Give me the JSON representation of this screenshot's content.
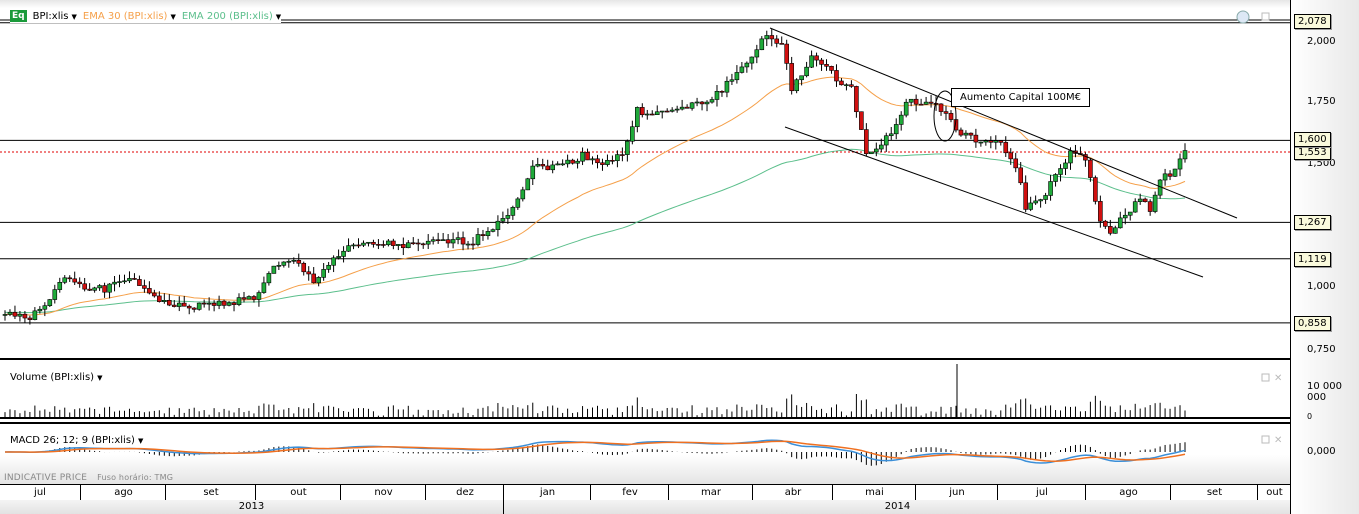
{
  "legend": {
    "badge": "Eq",
    "symbol": "BPI:xlis",
    "ema30": "EMA 30 (BPI:xlis)",
    "ema200": "EMA 200 (BPI:xlis)"
  },
  "colors": {
    "up": "#1faa3a",
    "down": "#d01010",
    "ema30": "#f5a04a",
    "ema200": "#5cbf8c",
    "macd": "#3b8fd8",
    "signal": "#f07020",
    "level": "#000000",
    "last": "#e00000"
  },
  "panels": {
    "volume_title": "Volume (BPI:xlis)",
    "macd_title": "MACD 26; 12; 9 (BPI:xlis)"
  },
  "footer": {
    "price_type": "INDICATIVE PRICE",
    "timezone": "Fuso horário: TMG"
  },
  "axis": {
    "price_ticks": [
      "2,000",
      "1,750",
      "1,500",
      "1,000",
      "0,750"
    ],
    "volume_ticks": [
      "10 000 000",
      "0"
    ],
    "macd_ticks": [
      "0,000"
    ]
  },
  "levels": [
    {
      "value": 2.078,
      "label": "2,078"
    },
    {
      "value": 1.6,
      "label": "1,600"
    },
    {
      "value": 1.553,
      "label": "1,553",
      "last": true
    },
    {
      "value": 1.267,
      "label": "1,267"
    },
    {
      "value": 1.119,
      "label": "1,119"
    },
    {
      "value": 0.858,
      "label": "0,858"
    }
  ],
  "annotation": "Aumento Capital 100M€",
  "months": [
    "jul",
    "ago",
    "set",
    "out",
    "nov",
    "dez",
    "jan",
    "fev",
    "mar",
    "abr",
    "mai",
    "jun",
    "jul",
    "ago",
    "set",
    "out"
  ],
  "years": [
    "2013",
    "2014"
  ],
  "chart_data": {
    "type": "candlestick",
    "ylim": [
      0.72,
      2.12
    ],
    "keypoints": [
      [
        1,
        0.9
      ],
      [
        4,
        0.87
      ],
      [
        8,
        0.92
      ],
      [
        12,
        1.05
      ],
      [
        16,
        1.01
      ],
      [
        20,
        0.99
      ],
      [
        24,
        1.04
      ],
      [
        28,
        1.0
      ],
      [
        32,
        0.94
      ],
      [
        36,
        0.92
      ],
      [
        40,
        0.93
      ],
      [
        44,
        0.94
      ],
      [
        50,
        0.96
      ],
      [
        54,
        1.08
      ],
      [
        58,
        1.11
      ],
      [
        62,
        1.03
      ],
      [
        66,
        1.12
      ],
      [
        70,
        1.17
      ],
      [
        76,
        1.18
      ],
      [
        82,
        1.17
      ],
      [
        88,
        1.19
      ],
      [
        94,
        1.19
      ],
      [
        98,
        1.25
      ],
      [
        102,
        1.33
      ],
      [
        106,
        1.49
      ],
      [
        112,
        1.5
      ],
      [
        116,
        1.54
      ],
      [
        120,
        1.51
      ],
      [
        124,
        1.54
      ],
      [
        127,
        1.72
      ],
      [
        132,
        1.71
      ],
      [
        138,
        1.74
      ],
      [
        142,
        1.77
      ],
      [
        146,
        1.85
      ],
      [
        150,
        1.94
      ],
      [
        152,
        2.02
      ],
      [
        156,
        1.99
      ],
      [
        158,
        1.81
      ],
      [
        162,
        1.94
      ],
      [
        166,
        1.87
      ],
      [
        170,
        1.81
      ],
      [
        173,
        1.55
      ],
      [
        175,
        1.58
      ],
      [
        178,
        1.62
      ],
      [
        181,
        1.76
      ],
      [
        186,
        1.75
      ],
      [
        189,
        1.71
      ],
      [
        192,
        1.62
      ],
      [
        196,
        1.6
      ],
      [
        200,
        1.58
      ],
      [
        203,
        1.5
      ],
      [
        205,
        1.33
      ],
      [
        208,
        1.36
      ],
      [
        211,
        1.45
      ],
      [
        214,
        1.55
      ],
      [
        217,
        1.52
      ],
      [
        220,
        1.27
      ],
      [
        222,
        1.23
      ],
      [
        225,
        1.29
      ],
      [
        228,
        1.37
      ],
      [
        230,
        1.32
      ],
      [
        232,
        1.45
      ],
      [
        235,
        1.47
      ],
      [
        237,
        1.56
      ]
    ],
    "series": [
      "price",
      "EMA 30",
      "EMA 200",
      "Volume",
      "MACD 26;12;9"
    ]
  }
}
